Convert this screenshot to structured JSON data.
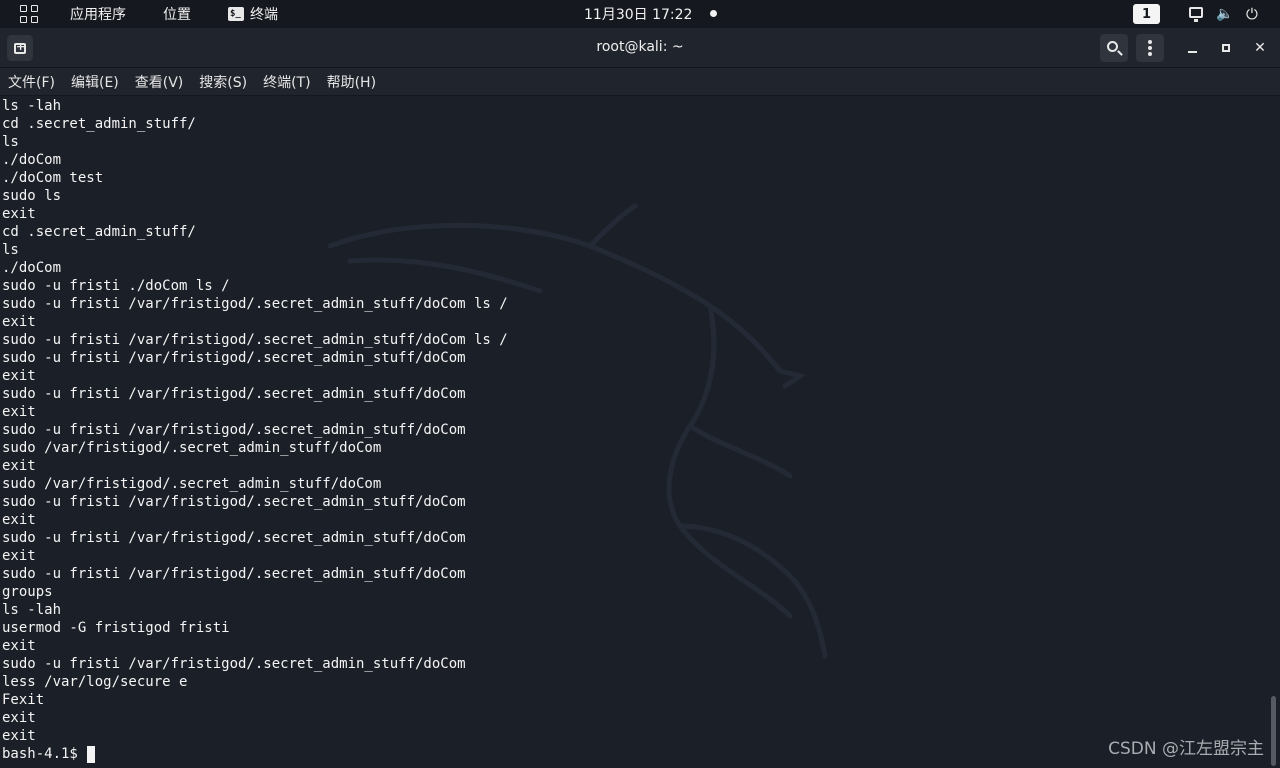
{
  "topbar": {
    "apps_menu": "应用程序",
    "places_menu": "位置",
    "terminal_menu": "终端",
    "clock": "11月30日  17:22",
    "workspace": "1"
  },
  "window": {
    "title": "root@kali: ~"
  },
  "menubar": {
    "items": [
      "文件(F)",
      "编辑(E)",
      "查看(V)",
      "搜索(S)",
      "终端(T)",
      "帮助(H)"
    ]
  },
  "terminal": {
    "lines": [
      "ls -lah",
      "cd .secret_admin_stuff/",
      "ls",
      "./doCom",
      "./doCom test",
      "sudo ls",
      "exit",
      "cd .secret_admin_stuff/",
      "ls",
      "./doCom",
      "sudo -u fristi ./doCom ls /",
      "sudo -u fristi /var/fristigod/.secret_admin_stuff/doCom ls /",
      "exit",
      "sudo -u fristi /var/fristigod/.secret_admin_stuff/doCom ls /",
      "sudo -u fristi /var/fristigod/.secret_admin_stuff/doCom",
      "exit",
      "sudo -u fristi /var/fristigod/.secret_admin_stuff/doCom",
      "exit",
      "sudo -u fristi /var/fristigod/.secret_admin_stuff/doCom",
      "sudo /var/fristigod/.secret_admin_stuff/doCom",
      "exit",
      "sudo /var/fristigod/.secret_admin_stuff/doCom",
      "sudo -u fristi /var/fristigod/.secret_admin_stuff/doCom",
      "exit",
      "sudo -u fristi /var/fristigod/.secret_admin_stuff/doCom",
      "exit",
      "sudo -u fristi /var/fristigod/.secret_admin_stuff/doCom",
      "groups",
      "ls -lah",
      "usermod -G fristigod fristi",
      "exit",
      "sudo -u fristi /var/fristigod/.secret_admin_stuff/doCom",
      "less /var/log/secure e",
      "Fexit",
      "exit",
      "exit"
    ],
    "prompt": "bash-4.1$"
  },
  "watermark": "CSDN @江左盟宗主"
}
